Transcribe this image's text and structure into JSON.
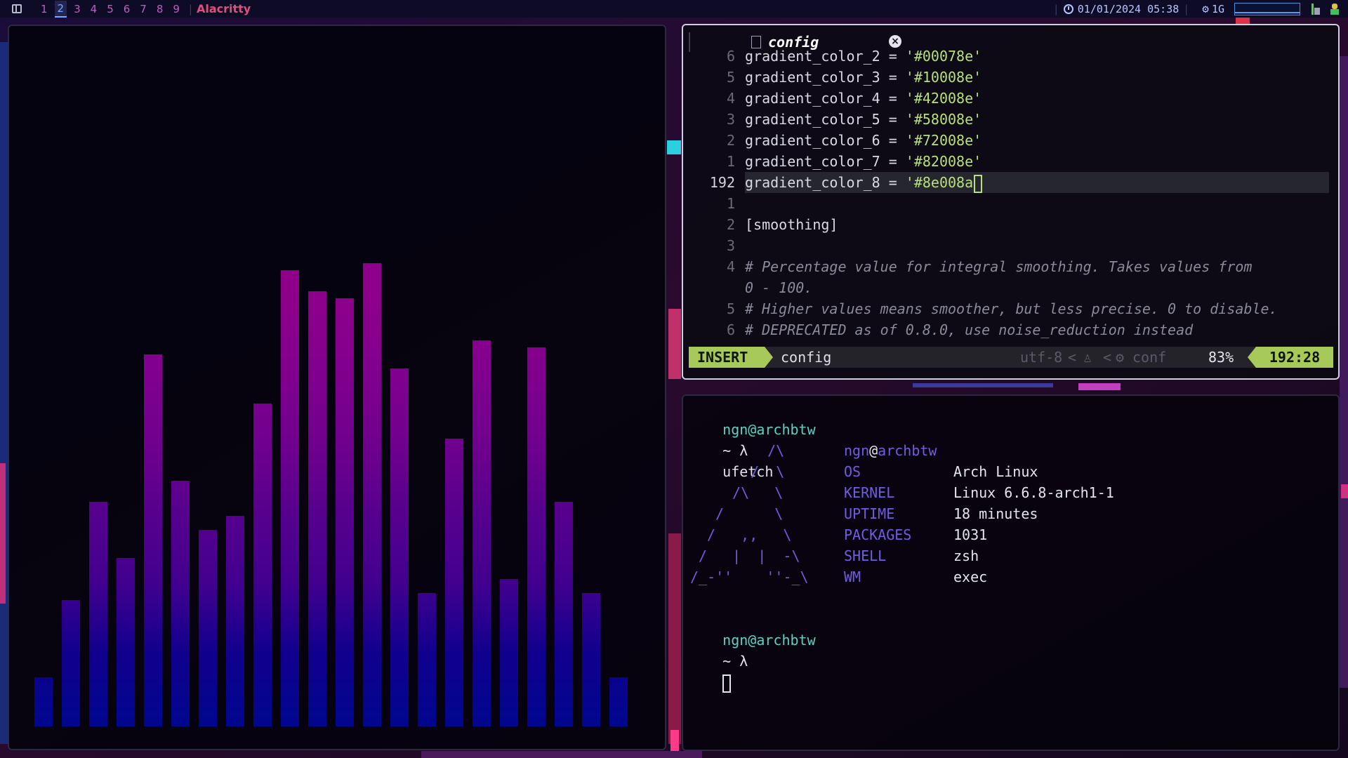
{
  "topbar": {
    "workspaces": [
      "1",
      "2",
      "3",
      "4",
      "5",
      "6",
      "7",
      "8",
      "9"
    ],
    "active_workspace": "2",
    "window_title": "Alacritty",
    "clock": "01/01/2024 05:38",
    "cpu_label": "1G"
  },
  "editor": {
    "tab_title": "config",
    "lines": [
      {
        "num": "6",
        "key": "gradient_color_2 = ",
        "str": "'#00078e'"
      },
      {
        "num": "5",
        "key": "gradient_color_3 = ",
        "str": "'#10008e'"
      },
      {
        "num": "4",
        "key": "gradient_color_4 = ",
        "str": "'#42008e'"
      },
      {
        "num": "3",
        "key": "gradient_color_5 = ",
        "str": "'#58008e'"
      },
      {
        "num": "2",
        "key": "gradient_color_6 = ",
        "str": "'#72008e'"
      },
      {
        "num": "1",
        "key": "gradient_color_7 = ",
        "str": "'#82008e'"
      },
      {
        "num": "192",
        "key": "gradient_color_8 = ",
        "str": "'#8e008a"
      },
      {
        "num": "1",
        "text": ""
      },
      {
        "num": "2",
        "text": "[smoothing]"
      },
      {
        "num": "3",
        "text": ""
      },
      {
        "num": "4",
        "comment": "# Percentage value for integral smoothing. Takes values from"
      },
      {
        "num": "",
        "comment": "0 - 100."
      },
      {
        "num": "5",
        "comment": "# Higher values means smoother, but less precise. 0 to disable."
      },
      {
        "num": "6",
        "comment": "# DEPRECATED as of 0.8.0, use noise_reduction instead"
      }
    ],
    "status": {
      "mode": "INSERT",
      "file": "config",
      "encoding": "utf-8",
      "filetype": "conf",
      "percent": "83%",
      "position": "192:28"
    }
  },
  "terminal": {
    "user": "ngn@archbtw",
    "tilde": "~ λ",
    "command": "ufetch",
    "ascii_art": [
      "   /\\",
      "  /  \\",
      " /\\   \\",
      "/      \\",
      "/   ,,   \\",
      "/   |  |  -\\",
      "/_-''    ''-_\\"
    ],
    "fetch_user": "ngn",
    "fetch_at": "@",
    "fetch_host": "archbtw",
    "info": [
      {
        "key": "OS",
        "value": "Arch Linux"
      },
      {
        "key": "KERNEL",
        "value": "Linux 6.6.8-arch1-1"
      },
      {
        "key": "UPTIME",
        "value": "18 minutes"
      },
      {
        "key": "PACKAGES",
        "value": "1031"
      },
      {
        "key": "SHELL",
        "value": "zsh"
      },
      {
        "key": "WM",
        "value": "exec"
      }
    ]
  },
  "visualizer": {
    "levels": [
      0.07,
      0.18,
      0.32,
      0.24,
      0.53,
      0.35,
      0.28,
      0.3,
      0.46,
      0.65,
      0.62,
      0.61,
      0.66,
      0.51,
      0.19,
      0.41,
      0.55,
      0.21,
      0.54,
      0.32,
      0.19,
      0.07
    ],
    "colors": [
      "#00078e",
      "#10008e",
      "#42008e",
      "#58008e",
      "#72008e",
      "#82008e",
      "#8e008a"
    ]
  }
}
